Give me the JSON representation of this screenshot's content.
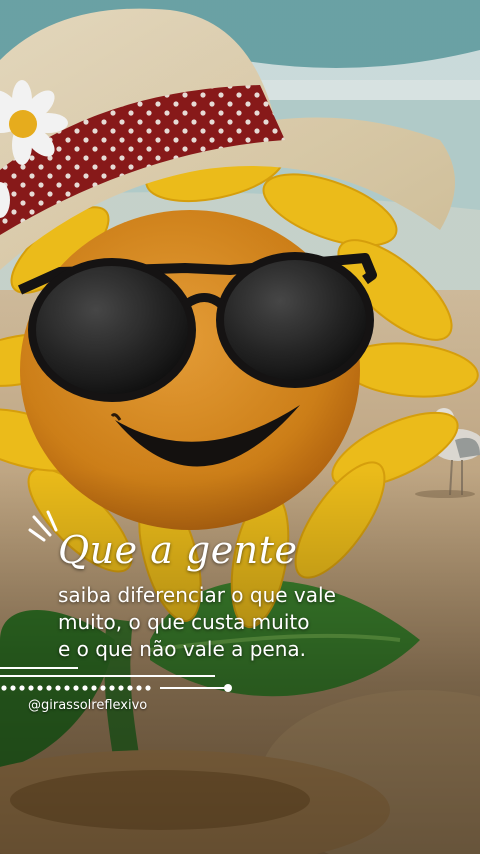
{
  "quote": {
    "headline": "Que a gente",
    "lines": [
      "saiba diferenciar o que vale",
      "muito, o que custa muito",
      "e o que não vale a pena."
    ]
  },
  "signature": {
    "handle": "@girassolreflexivo"
  },
  "scene": {
    "subject": "sunflower-with-sunglasses-and-straw-hat",
    "setting": "beach",
    "colors": {
      "petal": "#f7c51b",
      "face": "#d98a1c",
      "hat_band": "#8e1a1a",
      "sea": "#7fb3b8",
      "sand": "#d9b985"
    }
  }
}
